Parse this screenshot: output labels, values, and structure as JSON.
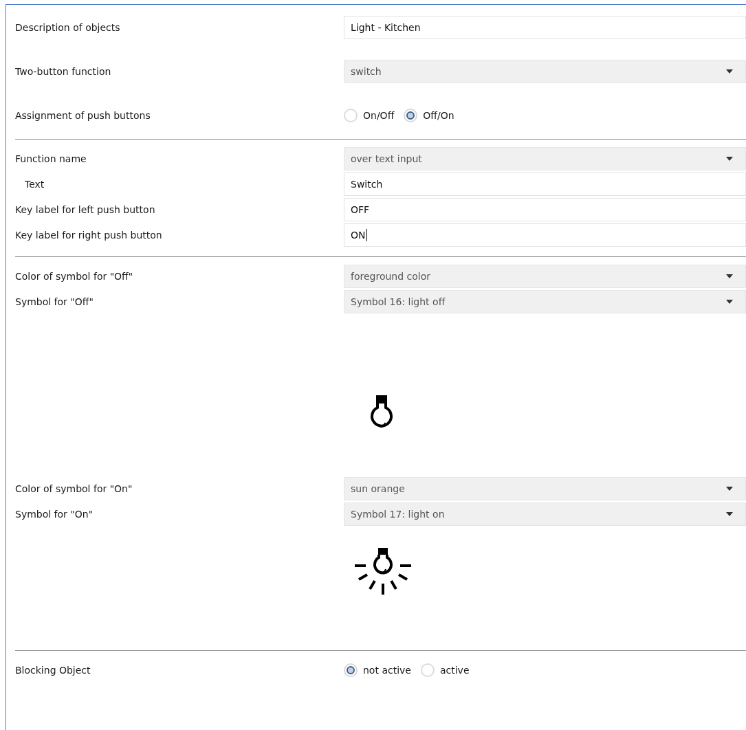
{
  "sections": [
    {
      "rows": [
        {
          "kind": "text",
          "label": "Description of objects",
          "value": "Light - Kitchen"
        },
        {
          "kind": "select",
          "label": "Two-button function",
          "value": "switch"
        },
        {
          "kind": "radio",
          "label": "Assignment of push buttons",
          "options": [
            {
              "label": "On/Off",
              "selected": false
            },
            {
              "label": "Off/On",
              "selected": true
            }
          ]
        }
      ]
    },
    {
      "rows": [
        {
          "kind": "select",
          "label": "Function name",
          "value": "over text input"
        },
        {
          "kind": "text",
          "label": "Text",
          "value": "Switch",
          "indented": true
        },
        {
          "kind": "text",
          "label": "Key label for left push button",
          "value": "OFF"
        },
        {
          "kind": "text",
          "label": "Key label for right push button",
          "value": "ON",
          "focused": true
        }
      ]
    },
    {
      "rows": [
        {
          "kind": "select",
          "label": "Color of symbol for \"Off\"",
          "value": "foreground color"
        },
        {
          "kind": "select",
          "label": "Symbol for \"Off\"",
          "value": "Symbol 16: light off"
        },
        {
          "kind": "symbol"
        },
        {
          "kind": "select",
          "label": "Color of symbol for \"On\"",
          "value": "sun orange"
        },
        {
          "kind": "select",
          "label": "Symbol for \"On\"",
          "value": "Symbol 17: light on"
        },
        {
          "kind": "symbol"
        }
      ]
    },
    {
      "rows": [
        {
          "kind": "radio",
          "label": "Blocking Object",
          "options": [
            {
              "label": "not active",
              "selected": true
            },
            {
              "label": "active",
              "selected": false
            }
          ]
        }
      ]
    }
  ]
}
